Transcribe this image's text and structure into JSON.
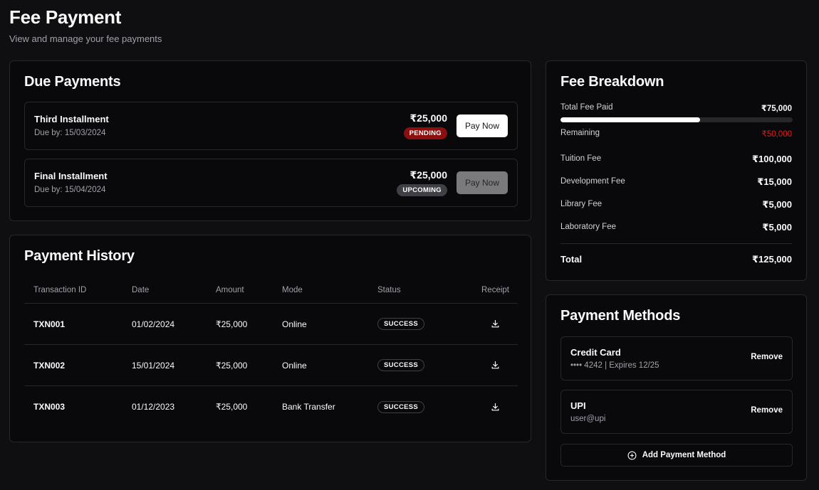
{
  "header": {
    "title": "Fee Payment",
    "subtitle": "View and manage your fee payments"
  },
  "due_payments": {
    "title": "Due Payments",
    "items": [
      {
        "name": "Third Installment",
        "due": "Due by: 15/03/2024",
        "amount": "₹25,000",
        "status": "PENDING",
        "button": "Pay Now"
      },
      {
        "name": "Final Installment",
        "due": "Due by: 15/04/2024",
        "amount": "₹25,000",
        "status": "UPCOMING",
        "button": "Pay Now"
      }
    ]
  },
  "history": {
    "title": "Payment History",
    "columns": [
      "Transaction ID",
      "Date",
      "Amount",
      "Mode",
      "Status",
      "Receipt"
    ],
    "rows": [
      {
        "id": "TXN001",
        "date": "01/02/2024",
        "amount": "₹25,000",
        "mode": "Online",
        "status": "SUCCESS"
      },
      {
        "id": "TXN002",
        "date": "15/01/2024",
        "amount": "₹25,000",
        "mode": "Online",
        "status": "SUCCESS"
      },
      {
        "id": "TXN003",
        "date": "01/12/2023",
        "amount": "₹25,000",
        "mode": "Bank Transfer",
        "status": "SUCCESS"
      }
    ]
  },
  "breakdown": {
    "title": "Fee Breakdown",
    "paid_label": "Total Fee Paid",
    "paid_value": "₹75,000",
    "paid_fraction": 0.6,
    "remaining_label": "Remaining",
    "remaining_value": "₹50,000",
    "items": [
      {
        "label": "Tuition Fee",
        "value": "₹100,000"
      },
      {
        "label": "Development Fee",
        "value": "₹15,000"
      },
      {
        "label": "Library Fee",
        "value": "₹5,000"
      },
      {
        "label": "Laboratory Fee",
        "value": "₹5,000"
      }
    ],
    "total_label": "Total",
    "total_value": "₹125,000"
  },
  "methods": {
    "title": "Payment Methods",
    "items": [
      {
        "name": "Credit Card",
        "detail": "•••• 4242 | Expires 12/25",
        "action": "Remove"
      },
      {
        "name": "UPI",
        "detail": "user@upi",
        "action": "Remove"
      }
    ],
    "add_label": "Add Payment Method"
  },
  "colors": {
    "background": "#0f0f11",
    "card": "#09090b",
    "pending_badge": "#8b0f0f",
    "remaining_red": "#e11d1d"
  }
}
